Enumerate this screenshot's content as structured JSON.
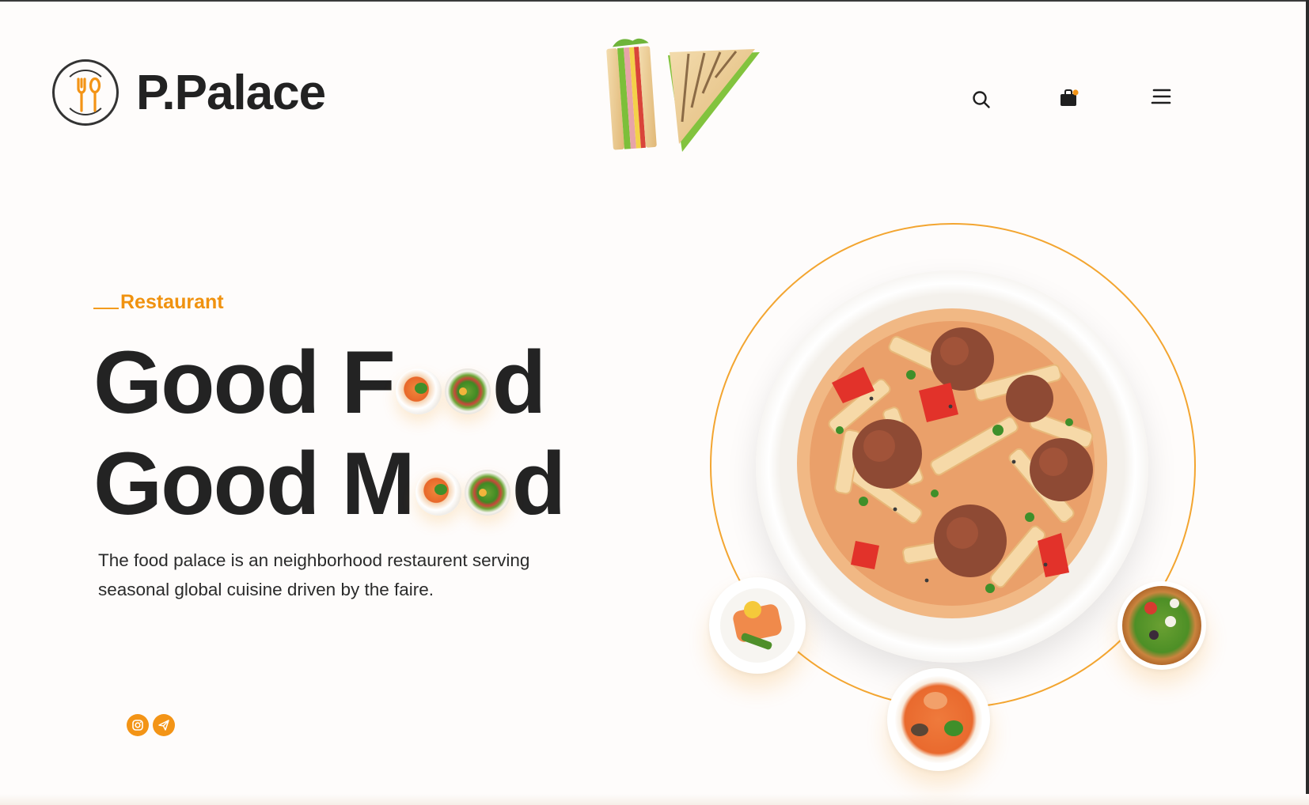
{
  "brand": {
    "name": "P.Palace"
  },
  "hero": {
    "eyebrow": "Restaurant",
    "line1_start": "Good F",
    "line1_end": "d",
    "line2_start": "Good M",
    "line2_end": "d",
    "description": "The food palace is an neighborhood restaurent serving seasonal global cuisine driven by the faire."
  },
  "header": {
    "icons": [
      "search-icon",
      "cart-icon",
      "menu-icon"
    ]
  },
  "social": {
    "icons": [
      "instagram-icon",
      "telegram-icon"
    ]
  },
  "colors": {
    "accent": "#f39416",
    "text": "#232323",
    "background": "#fefcfb"
  }
}
